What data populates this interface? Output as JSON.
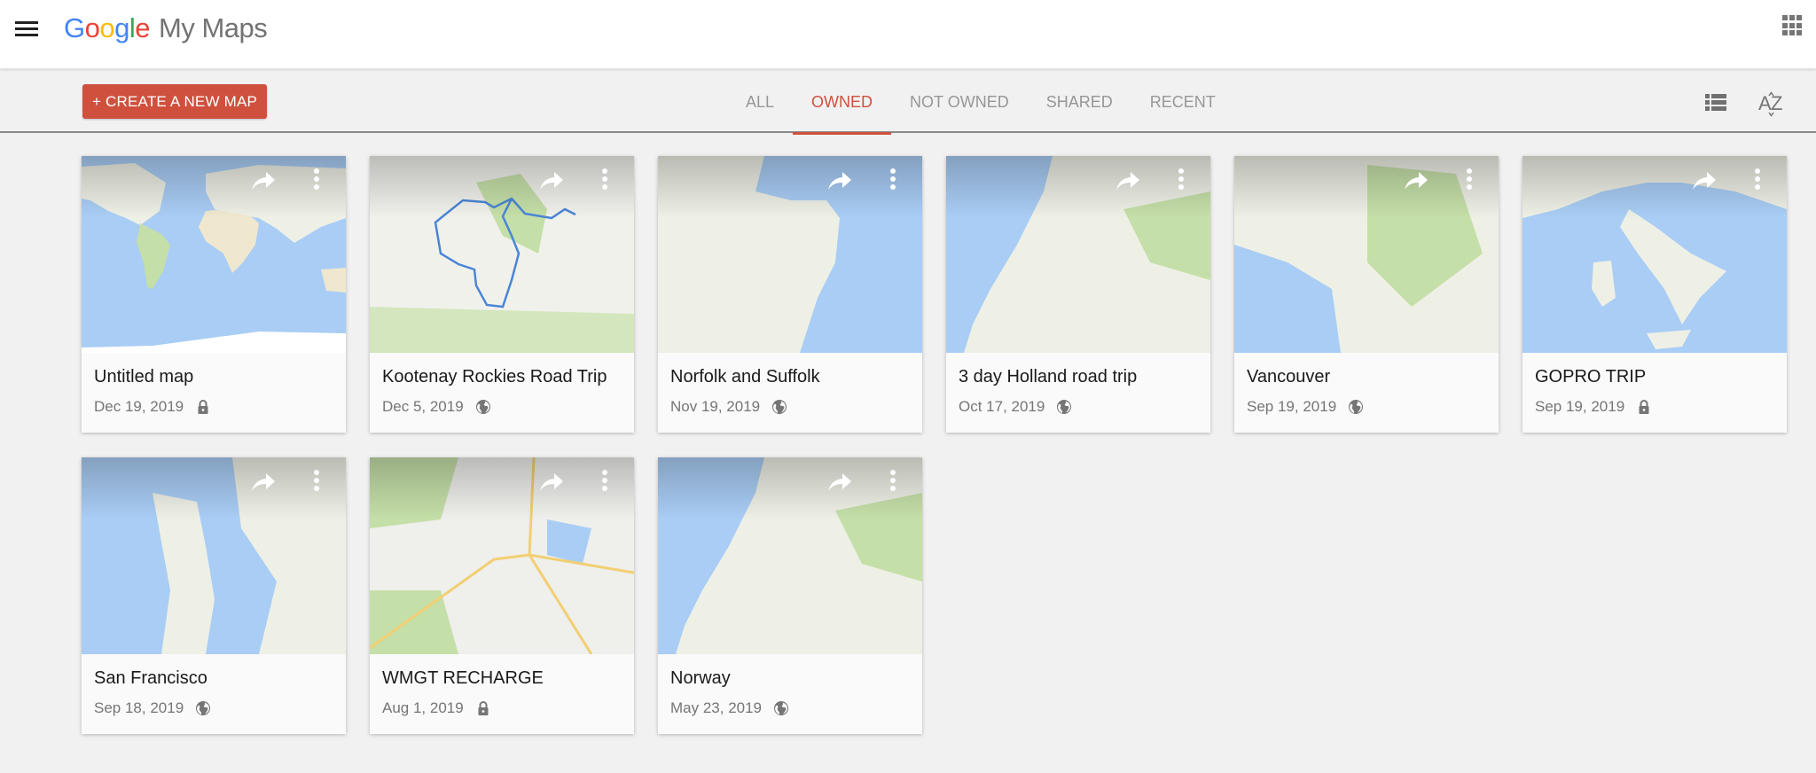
{
  "header": {
    "logo_letters": [
      "G",
      "o",
      "o",
      "g",
      "l",
      "e"
    ],
    "product_name": "My Maps",
    "menu_icon": "hamburger-menu-icon",
    "apps_icon": "apps-grid-icon"
  },
  "toolbar": {
    "create_button_label": "+ CREATE A NEW MAP",
    "tabs": [
      {
        "label": "ALL",
        "active": false
      },
      {
        "label": "OWNED",
        "active": true
      },
      {
        "label": "NOT OWNED",
        "active": false
      },
      {
        "label": "SHARED",
        "active": false
      },
      {
        "label": "RECENT",
        "active": false
      }
    ],
    "view_toggle_icon": "list-view-icon",
    "sort_icon": "sort-az-icon"
  },
  "colors": {
    "accent": "#d0503e",
    "background": "#f1f1f1",
    "tab_inactive": "#979797",
    "meta_text": "#757575",
    "water": "#a9cdf5",
    "land": "#eef0e6",
    "park": "#c5dfa8",
    "route": "#4a86d6"
  },
  "maps": [
    {
      "title": "Untitled map",
      "date": "Dec 19, 2019",
      "visibility": "private",
      "visibility_icon": "lock-icon",
      "thumbnail": "world"
    },
    {
      "title": "Kootenay Rockies Road Trip",
      "date": "Dec 5, 2019",
      "visibility": "public",
      "visibility_icon": "globe-icon",
      "thumbnail": "route"
    },
    {
      "title": "Norfolk and Suffolk",
      "date": "Nov 19, 2019",
      "visibility": "public",
      "visibility_icon": "globe-icon",
      "thumbnail": "coast-east"
    },
    {
      "title": "3 day Holland road trip",
      "date": "Oct 17, 2019",
      "visibility": "public",
      "visibility_icon": "globe-icon",
      "thumbnail": "coast-west"
    },
    {
      "title": "Vancouver",
      "date": "Sep 19, 2019",
      "visibility": "public",
      "visibility_icon": "globe-icon",
      "thumbnail": "inlet"
    },
    {
      "title": "GOPRO TRIP",
      "date": "Sep 19, 2019",
      "visibility": "private",
      "visibility_icon": "lock-icon",
      "thumbnail": "peninsula"
    },
    {
      "title": "San Francisco",
      "date": "Sep 18, 2019",
      "visibility": "public",
      "visibility_icon": "globe-icon",
      "thumbnail": "bay"
    },
    {
      "title": "WMGT RECHARGE",
      "date": "Aug 1, 2019",
      "visibility": "private",
      "visibility_icon": "lock-icon",
      "thumbnail": "roads"
    },
    {
      "title": "Norway",
      "date": "May 23, 2019",
      "visibility": "public",
      "visibility_icon": "globe-icon",
      "thumbnail": "coast-west"
    }
  ]
}
